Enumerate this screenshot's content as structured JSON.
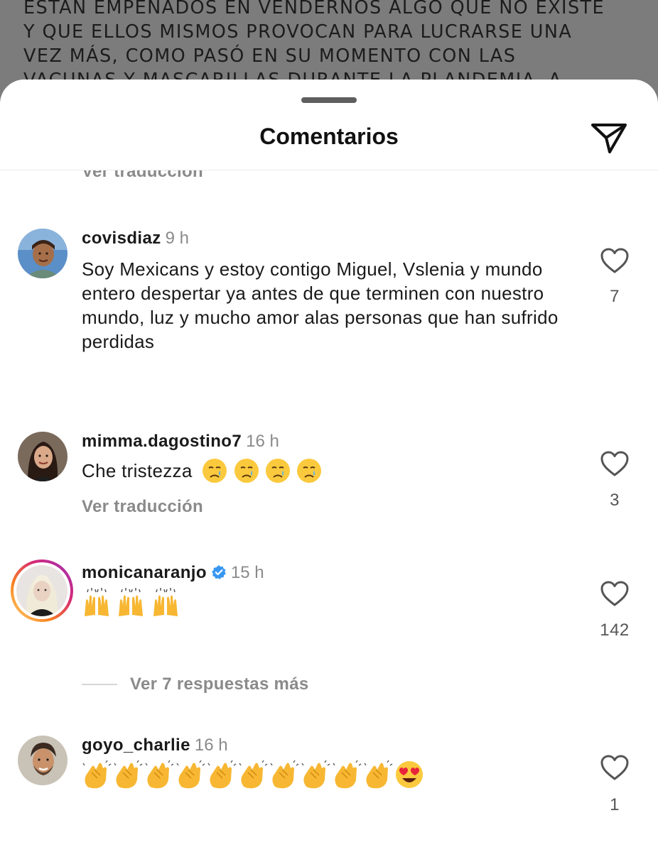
{
  "post_caption": {
    "lines": [
      "ESTÁN EMPEÑADOS EN VENDERNOS ALGO QUE NO EXISTE",
      "Y QUE ELLOS MISMOS PROVOCAN PARA LUCRARSE UNA",
      "VEZ MÁS, COMO PASÓ EN SU MOMENTO CON LAS",
      "VACUNAS Y MASCARILLAS DURANTE LA PLANDEMIA. A"
    ]
  },
  "sheet": {
    "title": "Comentarios",
    "share_icon": "paper-plane-icon"
  },
  "cut_off_translation": "Ver traducción",
  "comments": [
    {
      "username": "covisdiaz",
      "time": "9 h",
      "verified": false,
      "text": "Soy Mexicans y estoy contigo Miguel, Vslenia y mundo entero despertar ya antes de que terminen con nuestro mundo, luz y mucho amor alas personas que han sufrido perdidas",
      "likes": "7"
    },
    {
      "username": "mimma.dagostino7",
      "time": "16 h",
      "verified": false,
      "text": "Che tristezza",
      "emojis": [
        "crying-face",
        "crying-face",
        "crying-face",
        "crying-face"
      ],
      "translate_label": "Ver traducción",
      "likes": "3"
    },
    {
      "username": "monicanaranjo",
      "time": "15 h",
      "verified": true,
      "emojis": [
        "raising-hands",
        "raising-hands",
        "raising-hands"
      ],
      "likes": "142",
      "replies_label": "Ver 7 respuestas más"
    },
    {
      "username": "goyo_charlie",
      "time": "16 h",
      "verified": false,
      "emojis": [
        "clapping-hands",
        "clapping-hands",
        "clapping-hands",
        "clapping-hands",
        "clapping-hands",
        "clapping-hands",
        "clapping-hands",
        "clapping-hands",
        "clapping-hands",
        "clapping-hands",
        "heart-eyes-face"
      ],
      "likes": "1"
    }
  ],
  "colors": {
    "verified_badge": "#3897f0",
    "story_ring_start": "#feda75",
    "story_ring_end": "#d62976",
    "secondary_text": "#8a8a8a"
  }
}
